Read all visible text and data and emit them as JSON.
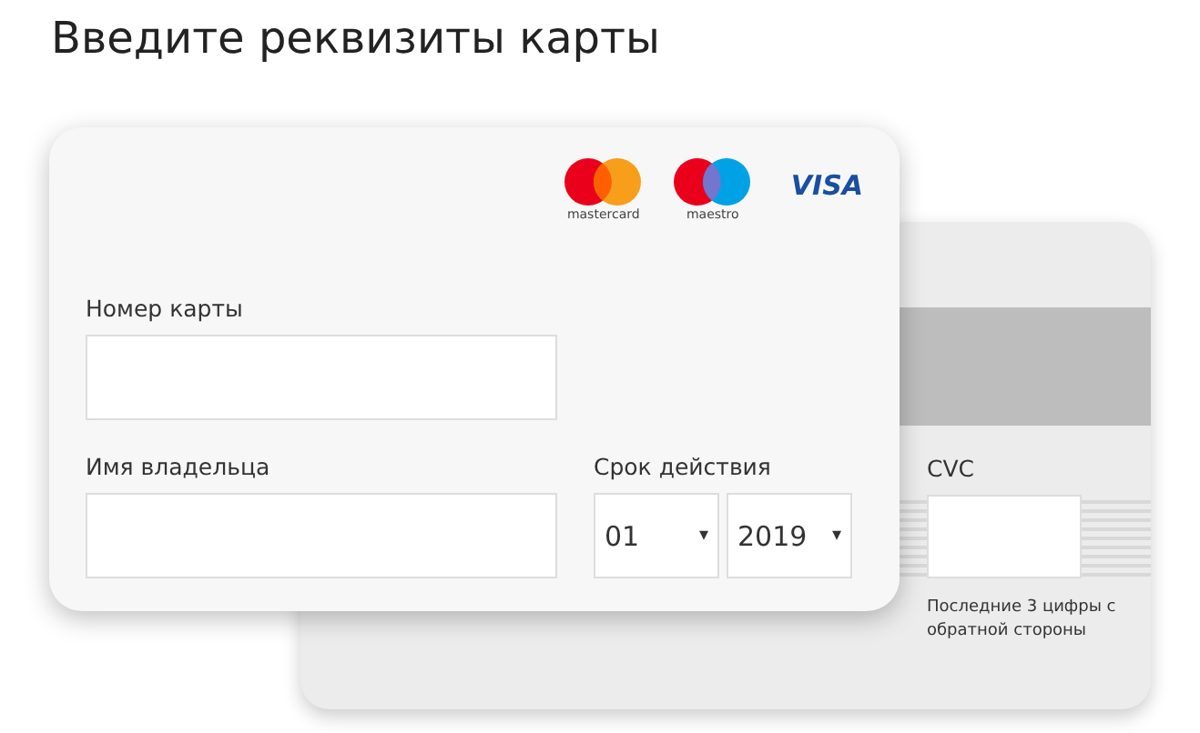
{
  "title": "Введите реквизиты карты",
  "brands": [
    {
      "kind": "mastercard",
      "label": "mastercard"
    },
    {
      "kind": "maestro",
      "label": "maestro"
    },
    {
      "kind": "visa",
      "label": "VISA"
    }
  ],
  "card_number": {
    "label": "Номер карты"
  },
  "holder": {
    "label": "Имя владельца"
  },
  "expiry": {
    "label": "Срок действия",
    "month": "01",
    "year": "2019",
    "caret": "▾"
  },
  "cvc": {
    "label": "CVC",
    "hint": "Последние 3 цифры с обратной стороны"
  }
}
